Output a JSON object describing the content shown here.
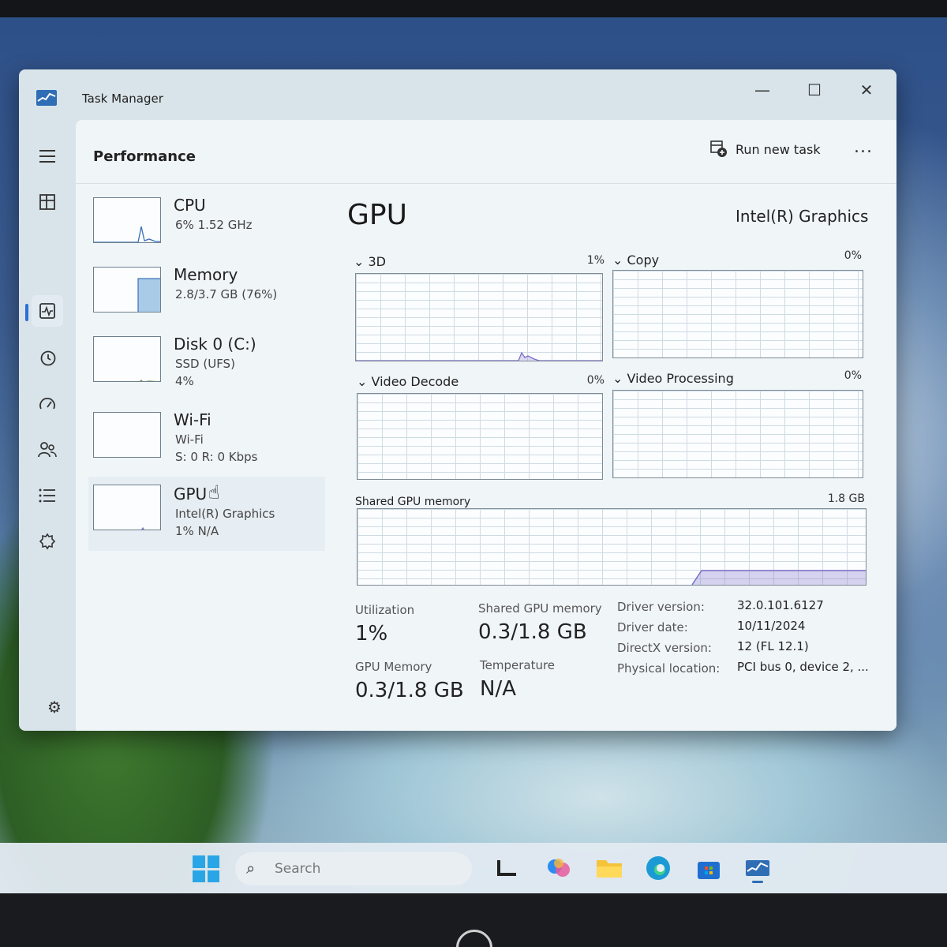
{
  "window": {
    "title": "Task Manager",
    "minimize": "—",
    "maximize": "☐",
    "close": "✕"
  },
  "header": {
    "title": "Performance",
    "run_new_task": "Run new task",
    "more": "..."
  },
  "devices": [
    {
      "name": "CPU",
      "line1": "6% 1.52 GHz",
      "line2": ""
    },
    {
      "name": "Memory",
      "line1": "2.8/3.7 GB (76%)",
      "line2": ""
    },
    {
      "name": "Disk 0 (C:)",
      "line1": "SSD (UFS)",
      "line2": "4%"
    },
    {
      "name": "Wi-Fi",
      "line1": "Wi-Fi",
      "line2": "S: 0 R: 0 Kbps"
    },
    {
      "name": "GPU",
      "line1": "Intel(R) Graphics",
      "line2": "1% N/A"
    }
  ],
  "gpu": {
    "title": "GPU",
    "model": "Intel(R) Graphics",
    "engines": [
      {
        "label": "3D",
        "pct": "1%"
      },
      {
        "label": "Copy",
        "pct": "0%"
      },
      {
        "label": "Video Decode",
        "pct": "0%"
      },
      {
        "label": "Video Processing",
        "pct": "0%"
      }
    ],
    "shared_label": "Shared GPU memory",
    "shared_max": "1.8 GB",
    "stats": {
      "utilization_label": "Utilization",
      "utilization_value": "1%",
      "shared_mem_label": "Shared GPU memory",
      "shared_mem_value": "0.3/1.8 GB",
      "gpu_mem_label": "GPU Memory",
      "gpu_mem_value": "0.3/1.8 GB",
      "temp_label": "Temperature",
      "temp_value": "N/A"
    },
    "driver": [
      {
        "label": "Driver version:",
        "value": "32.0.101.6127"
      },
      {
        "label": "Driver date:",
        "value": "10/11/2024"
      },
      {
        "label": "DirectX version:",
        "value": "12 (FL 12.1)"
      },
      {
        "label": "Physical location:",
        "value": "PCI bus 0, device 2, ..."
      }
    ]
  },
  "taskbar": {
    "search_placeholder": "Search"
  },
  "colors": {
    "accent": "#2d6fd6",
    "memory_fill": "#aacbe8",
    "graph_line": "#7a6fc9"
  }
}
